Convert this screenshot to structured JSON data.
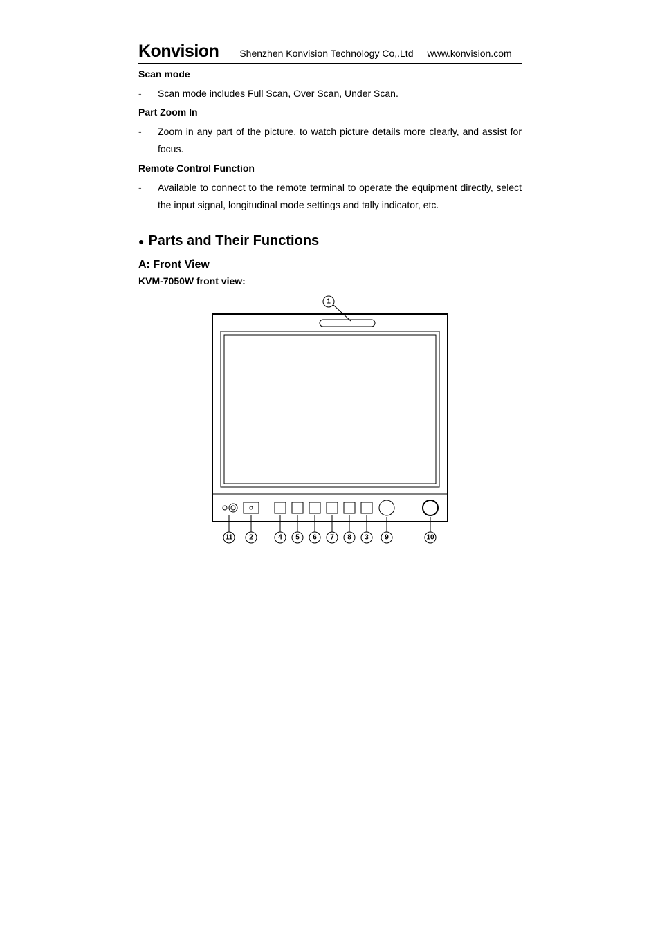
{
  "header": {
    "brand": "Konvision",
    "company": "Shenzhen Konvision Technology Co,.Ltd",
    "url": "www.konvision.com"
  },
  "sections": {
    "scan": {
      "title": "Scan mode",
      "text": "Scan mode includes Full Scan, Over Scan, Under Scan."
    },
    "zoom": {
      "title": "Part Zoom In",
      "text": "Zoom in any part of the picture, to watch picture details more clearly, and assist for focus."
    },
    "remote": {
      "title": "Remote Control Function",
      "text": "Available to connect to the remote terminal to operate the equipment directly, select the input signal, longitudinal mode settings and tally indicator, etc."
    }
  },
  "main": {
    "heading": "Parts and Their Functions",
    "sub": "A: Front View",
    "model": "KVM-7050W front view:"
  },
  "callouts": {
    "top": "1",
    "bottom": [
      "11",
      "2",
      "4",
      "5",
      "6",
      "7",
      "8",
      "3",
      "9",
      "10"
    ]
  }
}
